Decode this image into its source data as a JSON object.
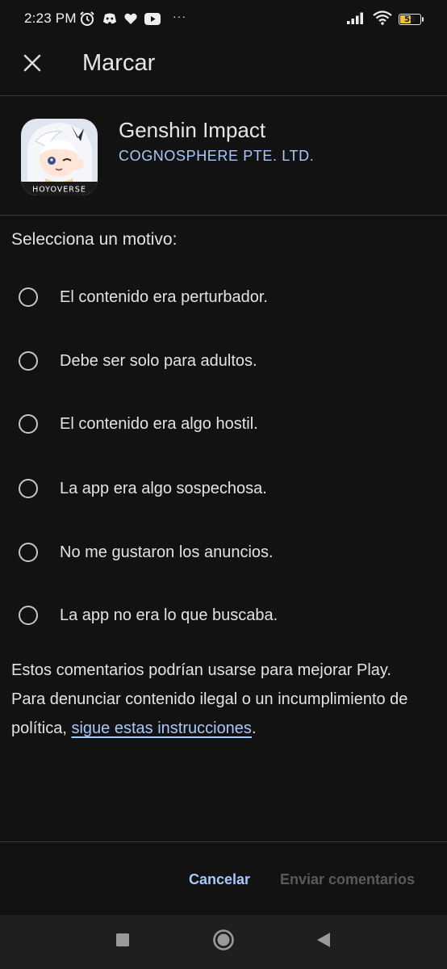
{
  "status_bar": {
    "time": "2:23 PM",
    "more": "···",
    "battery_level": "58",
    "battery_fraction": 0.58,
    "icons": [
      "alarm-icon",
      "discord-icon",
      "heart-icon",
      "youtube-icon",
      "signal-icon",
      "wifi-icon",
      "battery-icon"
    ]
  },
  "toolbar": {
    "title": "Marcar",
    "close_icon": "close-icon"
  },
  "app": {
    "name": "Genshin Impact",
    "developer": "COGNOSPHERE PTE. LTD.",
    "icon_text": "HOYOVERSE"
  },
  "reasons": {
    "title": "Selecciona un motivo:",
    "items": [
      {
        "label": "El contenido era perturbador."
      },
      {
        "label": "Debe ser solo para adultos."
      },
      {
        "label": "El contenido era algo hostil."
      },
      {
        "label": "La app era algo sospechosa."
      },
      {
        "label": "No me gustaron los anuncios."
      },
      {
        "label": "La app no era lo que buscaba."
      }
    ]
  },
  "info": {
    "text_before": "Estos comentarios podrían usarse para mejorar Play. Para denunciar contenido ilegal o un incumplimiento de política, ",
    "link_text": "sigue estas instrucciones",
    "text_after": "."
  },
  "footer": {
    "cancel_label": "Cancelar",
    "submit_label": "Enviar comentarios"
  },
  "colors": {
    "background": "#121212",
    "accent": "#a8c7fa",
    "text": "#e3e3e3",
    "disabled": "#5a5a5a"
  },
  "nav": {
    "icons": [
      "recents-square-icon",
      "home-circle-icon",
      "back-triangle-icon"
    ]
  }
}
